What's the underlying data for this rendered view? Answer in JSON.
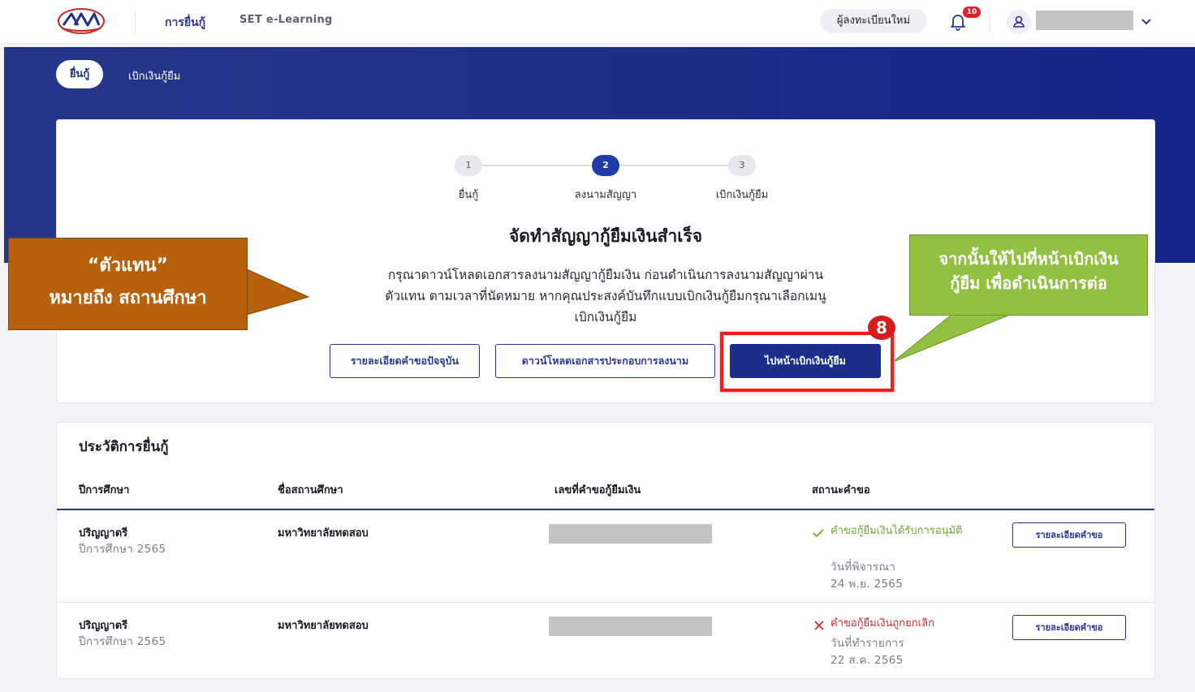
{
  "topnav": {
    "loan_link": "การยื่นกู้",
    "elearning_link": "SET e-Learning",
    "register_button": "ผู้ลงทะเบียนใหม่",
    "notification_count": "10"
  },
  "tabs": {
    "apply": "ยื่นกู้",
    "withdraw": "เบิกเงินกู้ยืม"
  },
  "stepper": {
    "current_step": 2,
    "steps": [
      {
        "num": "1",
        "label": "ยื่นกู้"
      },
      {
        "num": "2",
        "label": "ลงนามสัญญา"
      },
      {
        "num": "3",
        "label": "เบิกเงินกู้ยืม"
      }
    ]
  },
  "result": {
    "title": "จัดทำสัญญากู้ยืมเงินสำเร็จ",
    "description_line1": "กรุณาดาวน์โหลดเอกสารลงนามสัญญากู้ยืมเงิน ก่อนดำเนินการลงนามสัญญาผ่าน",
    "description_line2": "ตัวแทน ตามเวลาที่นัดหมาย หากคุณประสงค์บันทึกแบบเบิกเงินกู้ยืมกรุณาเลือกเมนู",
    "description_line3": "เบิกเงินกู้ยืม"
  },
  "actions": {
    "details_button": "รายละเอียดคำขอปัจจุบัน",
    "download_button": "ดาวน์โหลดเอกสารประกอบการลงนาม",
    "withdraw_button": "ไปหน้าเบิกเงินกู้ยืม"
  },
  "annotations": {
    "step_number": "8",
    "agent_note_line1": "“ตัวแทน”",
    "agent_note_line2": "หมายถึง สถานศึกษา",
    "next_note_line1": "จากนั้นให้ไปที่หน้าเบิกเงิน",
    "next_note_line2": "กู้ยืม เพื่อดำเนินการต่อ"
  },
  "history": {
    "title": "ประวัติการยื่นกู้",
    "columns": [
      "ปีการศึกษา",
      "ชื่อสถานศึกษา",
      "เลขที่คำขอกู้ยืมเงิน",
      "สถานะคำขอ"
    ],
    "rows": [
      {
        "level": "ปริญญาตรี",
        "year": "ปีการศึกษา 2565",
        "school": "มหาวิทยาลัยทดสอบ",
        "status": "คำขอกู้ยืมเงินได้รับการอนุมัติ",
        "date_label": "วันที่พิจารณา",
        "date": "24 พ.ย. 2565",
        "button": "รายละเอียดคำขอ"
      },
      {
        "level": "ปริญญาตรี",
        "year": "ปีการศึกษา 2565",
        "school": "มหาวิทยาลัยทดสอบ",
        "status": "คำขอกู้ยืมเงินถูกยกเลิก",
        "date_label": "วันที่ทำรายการ",
        "date": "22 ส.ค. 2565",
        "button": "รายละเอียดคำขอ"
      }
    ]
  },
  "colors": {
    "brand_navy": "#1d2e8a",
    "success_green": "#6aaa2e",
    "error_red": "#d42a2a",
    "highlight_red": "#ff1a1a",
    "callout_orange": "#b8610d",
    "callout_green": "#92c142"
  },
  "icons": {
    "bell": "bell-icon",
    "user": "user-icon",
    "chevron": "chevron-down-icon",
    "check": "check-icon",
    "cross": "close-icon"
  }
}
